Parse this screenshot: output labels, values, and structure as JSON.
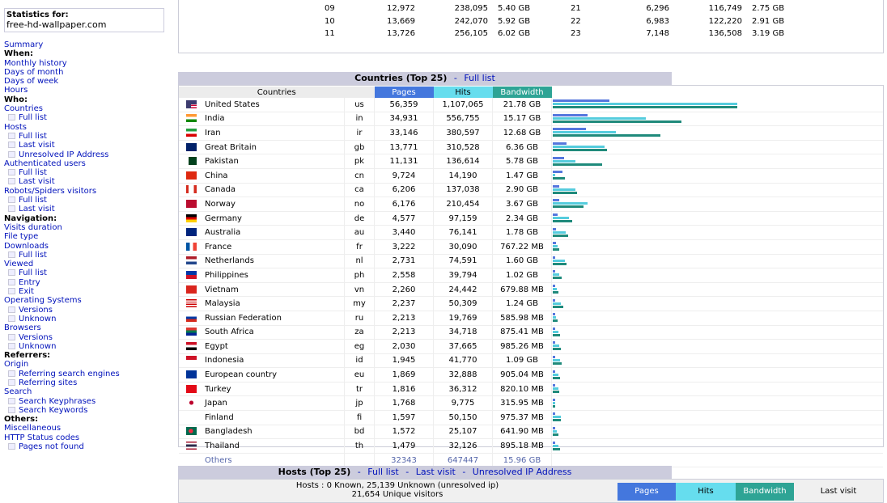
{
  "stats": {
    "title": "Statistics for:",
    "site": "free-hd-wallpaper.com"
  },
  "menu": [
    {
      "t": "link",
      "label": "Summary",
      "name": "menu-summary"
    },
    {
      "t": "head",
      "label": "When:",
      "name": "menu-when-heading"
    },
    {
      "t": "link",
      "label": "Monthly history",
      "name": "menu-monthly-history"
    },
    {
      "t": "link",
      "label": "Days of month",
      "name": "menu-days-of-month"
    },
    {
      "t": "link",
      "label": "Days of week",
      "name": "menu-days-of-week"
    },
    {
      "t": "link",
      "label": "Hours",
      "name": "menu-hours"
    },
    {
      "t": "head",
      "label": "Who:",
      "name": "menu-who-heading"
    },
    {
      "t": "link",
      "label": "Countries",
      "name": "menu-countries"
    },
    {
      "t": "sub",
      "label": "Full list",
      "name": "menu-countries-full-list"
    },
    {
      "t": "link",
      "label": "Hosts",
      "name": "menu-hosts"
    },
    {
      "t": "sub",
      "label": "Full list",
      "name": "menu-hosts-full-list"
    },
    {
      "t": "sub",
      "label": "Last visit",
      "name": "menu-hosts-last-visit"
    },
    {
      "t": "sub",
      "label": "Unresolved IP Address",
      "name": "menu-hosts-unresolved-ip"
    },
    {
      "t": "link",
      "label": "Authenticated users",
      "name": "menu-authenticated-users"
    },
    {
      "t": "sub",
      "label": "Full list",
      "name": "menu-auth-full-list"
    },
    {
      "t": "sub",
      "label": "Last visit",
      "name": "menu-auth-last-visit"
    },
    {
      "t": "link",
      "label": "Robots/Spiders visitors",
      "name": "menu-robots"
    },
    {
      "t": "sub",
      "label": "Full list",
      "name": "menu-robots-full-list"
    },
    {
      "t": "sub",
      "label": "Last visit",
      "name": "menu-robots-last-visit"
    },
    {
      "t": "head",
      "label": "Navigation:",
      "name": "menu-navigation-heading"
    },
    {
      "t": "link",
      "label": "Visits duration",
      "name": "menu-visits-duration"
    },
    {
      "t": "link",
      "label": "File type",
      "name": "menu-file-type"
    },
    {
      "t": "link",
      "label": "Downloads",
      "name": "menu-downloads"
    },
    {
      "t": "sub",
      "label": "Full list",
      "name": "menu-downloads-full-list"
    },
    {
      "t": "link",
      "label": "Viewed",
      "name": "menu-viewed"
    },
    {
      "t": "sub",
      "label": "Full list",
      "name": "menu-viewed-full-list"
    },
    {
      "t": "sub",
      "label": "Entry",
      "name": "menu-viewed-entry"
    },
    {
      "t": "sub",
      "label": "Exit",
      "name": "menu-viewed-exit"
    },
    {
      "t": "link",
      "label": "Operating Systems",
      "name": "menu-operating-systems"
    },
    {
      "t": "sub",
      "label": "Versions",
      "name": "menu-os-versions"
    },
    {
      "t": "sub",
      "label": "Unknown",
      "name": "menu-os-unknown"
    },
    {
      "t": "link",
      "label": "Browsers",
      "name": "menu-browsers"
    },
    {
      "t": "sub",
      "label": "Versions",
      "name": "menu-browsers-versions"
    },
    {
      "t": "sub",
      "label": "Unknown",
      "name": "menu-browsers-unknown"
    },
    {
      "t": "head",
      "label": "Referrers:",
      "name": "menu-referrers-heading"
    },
    {
      "t": "link",
      "label": "Origin",
      "name": "menu-origin"
    },
    {
      "t": "sub",
      "label": "Referring search engines",
      "name": "menu-referring-search-engines"
    },
    {
      "t": "sub",
      "label": "Referring sites",
      "name": "menu-referring-sites"
    },
    {
      "t": "link",
      "label": "Search",
      "name": "menu-search"
    },
    {
      "t": "sub",
      "label": "Search Keyphrases",
      "name": "menu-search-keyphrases"
    },
    {
      "t": "sub",
      "label": "Search Keywords",
      "name": "menu-search-keywords"
    },
    {
      "t": "head",
      "label": "Others:",
      "name": "menu-others-heading"
    },
    {
      "t": "link",
      "label": "Miscellaneous",
      "name": "menu-miscellaneous"
    },
    {
      "t": "link",
      "label": "HTTP Status codes",
      "name": "menu-http-status-codes"
    },
    {
      "t": "sub",
      "label": "Pages not found",
      "name": "menu-pages-not-found"
    }
  ],
  "hours_rows": [
    {
      "h1": "09",
      "p1": "12,972",
      "hi1": "238,095",
      "b1": "5.40 GB",
      "h2": "21",
      "p2": "6,296",
      "hi2": "116,749",
      "b2": "2.75 GB"
    },
    {
      "h1": "10",
      "p1": "13,669",
      "hi1": "242,070",
      "b1": "5.92 GB",
      "h2": "22",
      "p2": "6,983",
      "hi2": "122,220",
      "b2": "2.91 GB"
    },
    {
      "h1": "11",
      "p1": "13,726",
      "hi1": "256,105",
      "b1": "6.02 GB",
      "h2": "23",
      "p2": "7,148",
      "hi2": "136,508",
      "b2": "3.19 GB"
    }
  ],
  "countries": {
    "title": "Countries (Top 25)",
    "separator": "-",
    "full_list": "Full list",
    "headers": {
      "country": "Countries",
      "pages": "Pages",
      "hits": "Hits",
      "bandwidth": "Bandwidth"
    },
    "bar_colors": {
      "pages": "#5577dd",
      "hits": "#55ccdd",
      "bandwidth": "#1f8a7b"
    },
    "rows": [
      {
        "name": "United States",
        "code": "us",
        "pages": "56,359",
        "hits": "1,107,065",
        "bw": "21.78 GB",
        "pv": 56359,
        "hv": 1107065,
        "bv": 21.78,
        "flag": "us"
      },
      {
        "name": "India",
        "code": "in",
        "pages": "34,931",
        "hits": "556,755",
        "bw": "15.17 GB",
        "pv": 34931,
        "hv": 556755,
        "bv": 15.17,
        "flag": "in"
      },
      {
        "name": "Iran",
        "code": "ir",
        "pages": "33,146",
        "hits": "380,597",
        "bw": "12.68 GB",
        "pv": 33146,
        "hv": 380597,
        "bv": 12.68,
        "flag": "ir"
      },
      {
        "name": "Great Britain",
        "code": "gb",
        "pages": "13,771",
        "hits": "310,528",
        "bw": "6.36 GB",
        "pv": 13771,
        "hv": 310528,
        "bv": 6.36,
        "flag": "gb"
      },
      {
        "name": "Pakistan",
        "code": "pk",
        "pages": "11,131",
        "hits": "136,614",
        "bw": "5.78 GB",
        "pv": 11131,
        "hv": 136614,
        "bv": 5.78,
        "flag": "pk"
      },
      {
        "name": "China",
        "code": "cn",
        "pages": "9,724",
        "hits": "14,190",
        "bw": "1.47 GB",
        "pv": 9724,
        "hv": 14190,
        "bv": 1.47,
        "flag": "cn"
      },
      {
        "name": "Canada",
        "code": "ca",
        "pages": "6,206",
        "hits": "137,038",
        "bw": "2.90 GB",
        "pv": 6206,
        "hv": 137038,
        "bv": 2.9,
        "flag": "ca"
      },
      {
        "name": "Norway",
        "code": "no",
        "pages": "6,176",
        "hits": "210,454",
        "bw": "3.67 GB",
        "pv": 6176,
        "hv": 210454,
        "bv": 3.67,
        "flag": "no"
      },
      {
        "name": "Germany",
        "code": "de",
        "pages": "4,577",
        "hits": "97,159",
        "bw": "2.34 GB",
        "pv": 4577,
        "hv": 97159,
        "bv": 2.34,
        "flag": "de"
      },
      {
        "name": "Australia",
        "code": "au",
        "pages": "3,440",
        "hits": "76,141",
        "bw": "1.78 GB",
        "pv": 3440,
        "hv": 76141,
        "bv": 1.78,
        "flag": "au"
      },
      {
        "name": "France",
        "code": "fr",
        "pages": "3,222",
        "hits": "30,090",
        "bw": "767.22 MB",
        "pv": 3222,
        "hv": 30090,
        "bv": 0.749,
        "flag": "fr"
      },
      {
        "name": "Netherlands",
        "code": "nl",
        "pages": "2,731",
        "hits": "74,591",
        "bw": "1.60 GB",
        "pv": 2731,
        "hv": 74591,
        "bv": 1.6,
        "flag": "nl"
      },
      {
        "name": "Philippines",
        "code": "ph",
        "pages": "2,558",
        "hits": "39,794",
        "bw": "1.02 GB",
        "pv": 2558,
        "hv": 39794,
        "bv": 1.02,
        "flag": "ph"
      },
      {
        "name": "Vietnam",
        "code": "vn",
        "pages": "2,260",
        "hits": "24,442",
        "bw": "679.88 MB",
        "pv": 2260,
        "hv": 24442,
        "bv": 0.664,
        "flag": "vn"
      },
      {
        "name": "Malaysia",
        "code": "my",
        "pages": "2,237",
        "hits": "50,309",
        "bw": "1.24 GB",
        "pv": 2237,
        "hv": 50309,
        "bv": 1.24,
        "flag": "my"
      },
      {
        "name": "Russian Federation",
        "code": "ru",
        "pages": "2,213",
        "hits": "19,769",
        "bw": "585.98 MB",
        "pv": 2213,
        "hv": 19769,
        "bv": 0.572,
        "flag": "ru"
      },
      {
        "name": "South Africa",
        "code": "za",
        "pages": "2,213",
        "hits": "34,718",
        "bw": "875.41 MB",
        "pv": 2213,
        "hv": 34718,
        "bv": 0.855,
        "flag": "za"
      },
      {
        "name": "Egypt",
        "code": "eg",
        "pages": "2,030",
        "hits": "37,665",
        "bw": "985.26 MB",
        "pv": 2030,
        "hv": 37665,
        "bv": 0.962,
        "flag": "eg"
      },
      {
        "name": "Indonesia",
        "code": "id",
        "pages": "1,945",
        "hits": "41,770",
        "bw": "1.09 GB",
        "pv": 1945,
        "hv": 41770,
        "bv": 1.09,
        "flag": "id"
      },
      {
        "name": "European country",
        "code": "eu",
        "pages": "1,869",
        "hits": "32,888",
        "bw": "905.04 MB",
        "pv": 1869,
        "hv": 32888,
        "bv": 0.884,
        "flag": "eu"
      },
      {
        "name": "Turkey",
        "code": "tr",
        "pages": "1,816",
        "hits": "36,312",
        "bw": "820.10 MB",
        "pv": 1816,
        "hv": 36312,
        "bv": 0.801,
        "flag": "tr"
      },
      {
        "name": "Japan",
        "code": "jp",
        "pages": "1,768",
        "hits": "9,775",
        "bw": "315.95 MB",
        "pv": 1768,
        "hv": 9775,
        "bv": 0.309,
        "flag": "jp"
      },
      {
        "name": "Finland",
        "code": "fi",
        "pages": "1,597",
        "hits": "50,150",
        "bw": "975.37 MB",
        "pv": 1597,
        "hv": 50150,
        "bv": 0.953,
        "flag": "fi"
      },
      {
        "name": "Bangladesh",
        "code": "bd",
        "pages": "1,572",
        "hits": "25,107",
        "bw": "641.90 MB",
        "pv": 1572,
        "hv": 25107,
        "bv": 0.627,
        "flag": "bd"
      },
      {
        "name": "Thailand",
        "code": "th",
        "pages": "1,479",
        "hits": "32,126",
        "bw": "895.18 MB",
        "pv": 1479,
        "hv": 32126,
        "bv": 0.874,
        "flag": "th"
      }
    ],
    "others": {
      "label": "Others",
      "pages": "32343",
      "hits": "647447",
      "bw": "15.96 GB"
    }
  },
  "hosts": {
    "title": "Hosts (Top 25)",
    "separator": "-",
    "links": [
      "Full list",
      "Last visit",
      "Unresolved IP Address"
    ],
    "summary_line1": "Hosts : 0 Known, 25,139 Unknown (unresolved ip)",
    "summary_line2": "21,654 Unique visitors",
    "headers": {
      "pages": "Pages",
      "hits": "Hits",
      "bandwidth": "Bandwidth",
      "last_visit": "Last visit"
    }
  }
}
